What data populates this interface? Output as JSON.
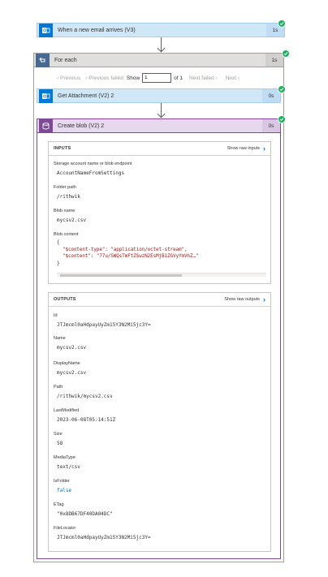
{
  "steps": {
    "trigger": {
      "title": "When a new email arrives (V3)",
      "duration": "1s"
    },
    "foreach": {
      "title": "For each",
      "duration": "1s"
    },
    "get_attachment": {
      "title": "Get Attachment (V2) 2",
      "duration": "0s"
    },
    "create_blob": {
      "title": "Create blob (V2) 2",
      "duration": "0s"
    }
  },
  "pager": {
    "previous": "Previous",
    "previous_failed": "Previous failed",
    "show": "Show",
    "page_value": "1",
    "of": "of 1",
    "next_failed": "Next failed",
    "next": "Next"
  },
  "inputs": {
    "heading": "INPUTS",
    "show_raw": "Show raw inputs",
    "storage_label": "Storage account name or blob endpoint",
    "storage_value": "AccountNameFromSettings",
    "folder_label": "Folder path",
    "folder_value": "/rithwik",
    "blobname_label": "Blob name",
    "blobname_value": "mycsv2.csv",
    "content_label": "Blob content",
    "content_lines": [
      "{",
      "  \"$content-type\": \"application/octet-stream\",",
      "  \"$content\": \"77u/SWQsTmFtZSwzN2EsMjB1ZGVyYmVhZ…\"",
      "}"
    ]
  },
  "outputs": {
    "heading": "OUTPUTS",
    "show_raw": "Show raw outputs",
    "id_label": "Id",
    "id_value": "JTJmcml0aHdpayUyZm15Y3N2Mi5jc3Y=",
    "name_label": "Name",
    "name_value": "mycsv2.csv",
    "display_label": "DisplayName",
    "display_value": "mycsv2.csv",
    "path_label": "Path",
    "path_value": "/rithwik/mycsv2.csv",
    "modified_label": "LastModified",
    "modified_value": "2023-06-08T05:14:51Z",
    "size_label": "Size",
    "size_value": "58",
    "media_label": "MediaType",
    "media_value": "text/csv",
    "isfolder_label": "IsFolder",
    "isfolder_value": "false",
    "etag_label": "ETag",
    "etag_value": "\"0x8DB67DF40DA04DC\"",
    "locator_label": "FileLocator",
    "locator_value": "JTJmcml0aHdpayUyZm15Y3N2Mi5jc3Y="
  },
  "colors": {
    "email_blue": "#0078d4",
    "blob_purple": "#804998",
    "success_green": "#19b25d",
    "link_blue": "#0078d4"
  },
  "icons": {
    "trigger": "outlook-icon",
    "foreach": "loop-icon",
    "attachment": "outlook-icon",
    "blob": "azure-blob-icon",
    "status": "success-check-icon"
  }
}
